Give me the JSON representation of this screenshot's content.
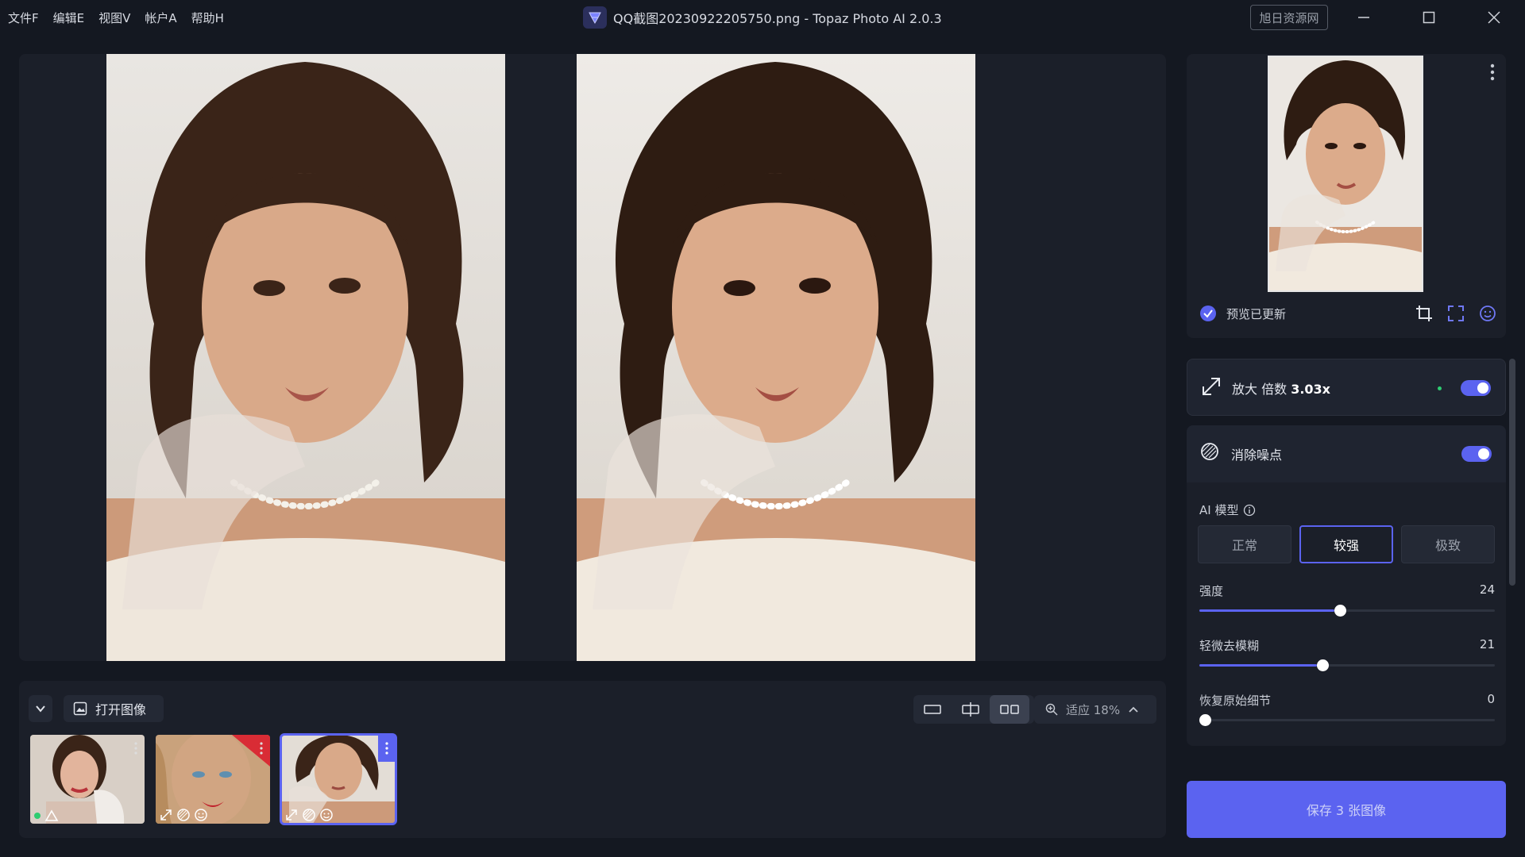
{
  "menu": [
    "文件F",
    "编辑E",
    "视图V",
    "帐户A",
    "帮助H"
  ],
  "window_title": "QQ截图20230922205750.png - Topaz Photo AI 2.0.3",
  "watermark_label": "旭日资源网",
  "bottom": {
    "open_label": "打开图像",
    "zoom_label": "适应 18%"
  },
  "thumbnails": [
    {
      "name": "woman-holding-glove",
      "badges": [
        "status-dot",
        "warning-icon"
      ],
      "selected": false
    },
    {
      "name": "woman-blue-eyes",
      "badges": [
        "upscale-icon",
        "denoise-icon",
        "face-icon"
      ],
      "selected": false
    },
    {
      "name": "woman-pearl-necklace",
      "badges": [
        "upscale-icon",
        "denoise-icon",
        "face-icon"
      ],
      "selected": true
    }
  ],
  "preview": {
    "status": "预览已更新"
  },
  "upscale": {
    "label": "放大 倍数",
    "value": "3.03x",
    "enabled": true
  },
  "denoise": {
    "label": "消除噪点",
    "enabled": true,
    "model_label": "AI 模型",
    "models": [
      "正常",
      "较强",
      "极致"
    ],
    "selected_model": "较强",
    "sliders": [
      {
        "label": "强度",
        "value": "24",
        "fraction": 0.24
      },
      {
        "label": "轻微去模糊",
        "value": "21",
        "fraction": 0.21
      },
      {
        "label": "恢复原始细节",
        "value": "0",
        "fraction": 0.0
      }
    ]
  },
  "save_label": "保存 3 张图像",
  "colors": {
    "accent": "#5b63f0",
    "background": "#141821",
    "panel": "#1b1f29"
  }
}
